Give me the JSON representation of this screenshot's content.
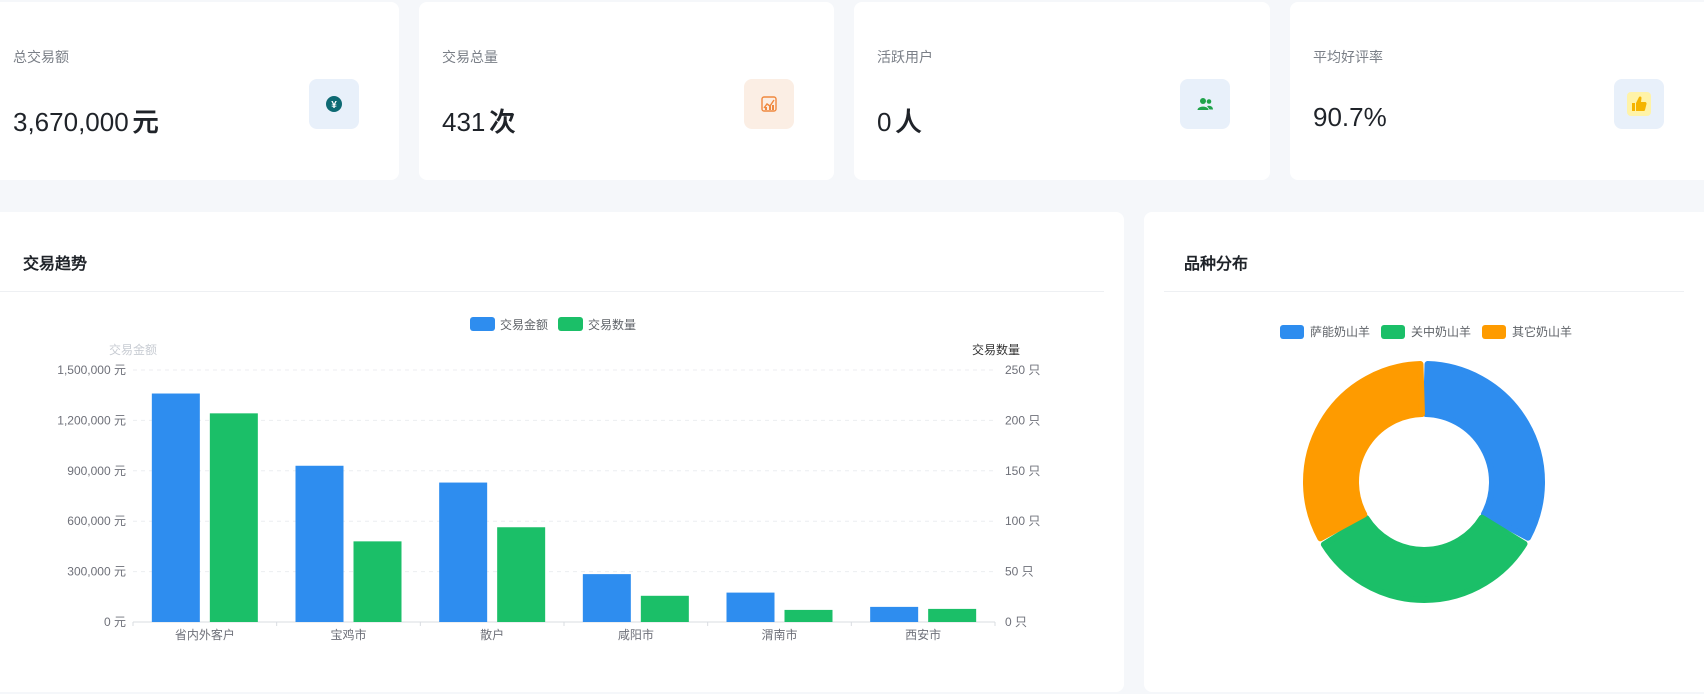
{
  "stats": [
    {
      "label": "总交易额",
      "value": "3,670,000",
      "unit": "元",
      "icon": "yuan-icon",
      "icon_bg": "#e8f0fa",
      "icon_color": "#0e6a73"
    },
    {
      "label": "交易总量",
      "value": "431",
      "unit": "次",
      "icon": "trend-chart-icon",
      "icon_bg": "#fbeee4",
      "icon_color": "#f0883e"
    },
    {
      "label": "活跃用户",
      "value": "0",
      "unit": "人",
      "icon": "users-icon",
      "icon_bg": "#e8f0fa",
      "icon_color": "#1fa34a"
    },
    {
      "label": "平均好评率",
      "value": "90.7%",
      "unit": "",
      "icon": "thumbs-up-icon",
      "icon_bg": "#e8f0fa",
      "icon_color": "#f5c518"
    }
  ],
  "trend_panel": {
    "title": "交易趋势"
  },
  "variety_panel": {
    "title": "品种分布"
  },
  "chart_data": [
    {
      "type": "bar",
      "title": "交易趋势",
      "categories": [
        "省内外客户",
        "宝鸡市",
        "散户",
        "咸阳市",
        "渭南市",
        "西安市"
      ],
      "series": [
        {
          "name": "交易金额",
          "axis": "left",
          "color": "#2e8def",
          "values": [
            1360000,
            930000,
            830000,
            285000,
            175000,
            90000
          ]
        },
        {
          "name": "交易数量",
          "axis": "right",
          "color": "#1bbf68",
          "values": [
            207,
            80,
            94,
            26,
            12,
            13
          ]
        }
      ],
      "y_left": {
        "label": "交易金额",
        "unit": "元",
        "ylim": [
          0,
          1500000
        ],
        "ticks": [
          "0 元",
          "300,000 元",
          "600,000 元",
          "900,000 元",
          "1,200,000 元",
          "1,500,000 元"
        ]
      },
      "y_right": {
        "label": "交易数量",
        "unit": "只",
        "ylim": [
          0,
          250
        ],
        "ticks": [
          "0 只",
          "50 只",
          "100 只",
          "150 只",
          "200 只",
          "250 只"
        ]
      },
      "grid": true,
      "legend": "top-center"
    },
    {
      "type": "pie",
      "title": "品种分布",
      "donut": true,
      "labels": [
        "萨能奶山羊",
        "关中奶山羊",
        "其它奶山羊"
      ],
      "values": [
        33.3,
        33.3,
        33.4
      ],
      "colors": [
        "#2e8def",
        "#1bbf68",
        "#fe9b00"
      ],
      "legend": "top-center"
    }
  ]
}
